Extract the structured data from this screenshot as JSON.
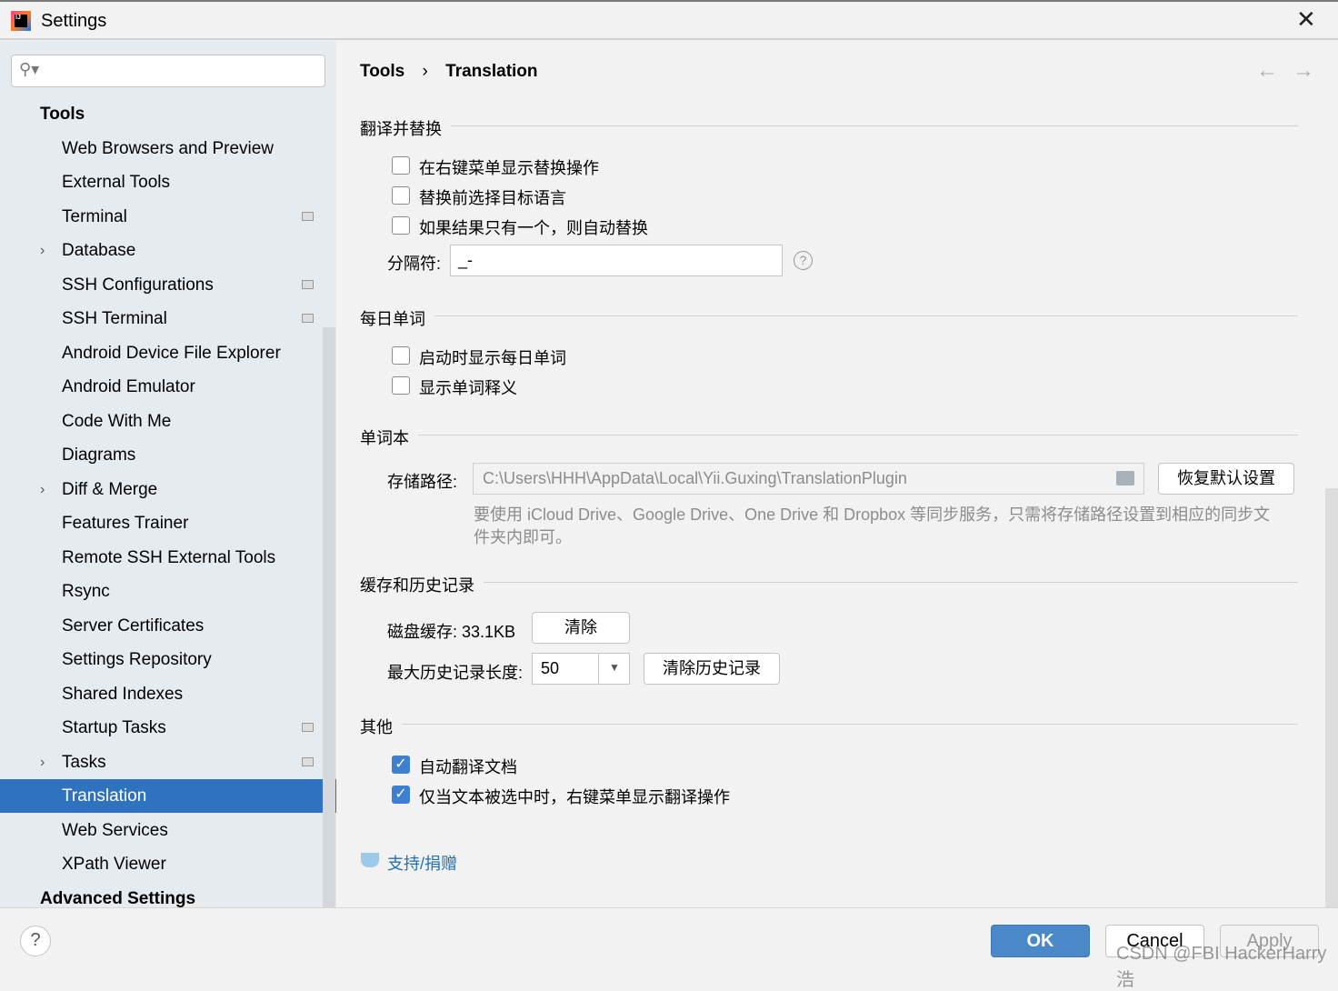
{
  "window": {
    "title": "Settings",
    "icon": "intellij-logo-icon"
  },
  "search": {
    "placeholder": ""
  },
  "sidebar": {
    "items": [
      {
        "label": "Tools",
        "top": true
      },
      {
        "label": "Web Browsers and Preview"
      },
      {
        "label": "External Tools"
      },
      {
        "label": "Terminal",
        "proj": true
      },
      {
        "label": "Database",
        "chevron": true
      },
      {
        "label": "SSH Configurations",
        "proj": true
      },
      {
        "label": "SSH Terminal",
        "proj": true
      },
      {
        "label": "Android Device File Explorer"
      },
      {
        "label": "Android Emulator"
      },
      {
        "label": "Code With Me"
      },
      {
        "label": "Diagrams"
      },
      {
        "label": "Diff & Merge",
        "chevron": true
      },
      {
        "label": "Features Trainer"
      },
      {
        "label": "Remote SSH External Tools"
      },
      {
        "label": "Rsync"
      },
      {
        "label": "Server Certificates"
      },
      {
        "label": "Settings Repository"
      },
      {
        "label": "Shared Indexes"
      },
      {
        "label": "Startup Tasks",
        "proj": true
      },
      {
        "label": "Tasks",
        "chevron": true,
        "proj": true
      },
      {
        "label": "Translation",
        "selected": true
      },
      {
        "label": "Web Services"
      },
      {
        "label": "XPath Viewer"
      },
      {
        "label": "Advanced Settings",
        "top": true
      }
    ]
  },
  "breadcrumb": {
    "parent": "Tools",
    "sep": "›",
    "current": "Translation"
  },
  "sections": {
    "replace": {
      "title": "翻译并替换",
      "opt1": "在右键菜单显示替换操作",
      "opt2": "替换前选择目标语言",
      "opt3": "如果结果只有一个，则自动替换",
      "sep_label": "分隔符:",
      "sep_value": "_-"
    },
    "daily": {
      "title": "每日单词",
      "opt1": "启动时显示每日单词",
      "opt2": "显示单词释义"
    },
    "wordbook": {
      "title": "单词本",
      "path_label": "存储路径:",
      "path_value": "C:\\Users\\HHH\\AppData\\Local\\Yii.Guxing\\TranslationPlugin",
      "reset": "恢复默认设置",
      "hint": "要使用 iCloud Drive、Google Drive、One Drive 和 Dropbox 等同步服务，只需将存储路径设置到相应的同步文件夹内即可。"
    },
    "cache": {
      "title": "缓存和历史记录",
      "disk_label": "磁盘缓存: 33.1KB",
      "clear": "清除",
      "max_label": "最大历史记录长度:",
      "max_value": "50",
      "clear_history": "清除历史记录"
    },
    "other": {
      "title": "其他",
      "opt1": "自动翻译文档",
      "opt1_checked": true,
      "opt2": "仅当文本被选中时，右键菜单显示翻译操作",
      "opt2_checked": true
    },
    "support": "支持/捐赠"
  },
  "footer": {
    "ok": "OK",
    "cancel": "Cancel",
    "apply": "Apply",
    "watermark": "CSDN @FBI HackerHarry浩"
  },
  "colors": {
    "accent": "#2f73c0",
    "ok": "#4a88c7",
    "link": "#2470b3"
  }
}
